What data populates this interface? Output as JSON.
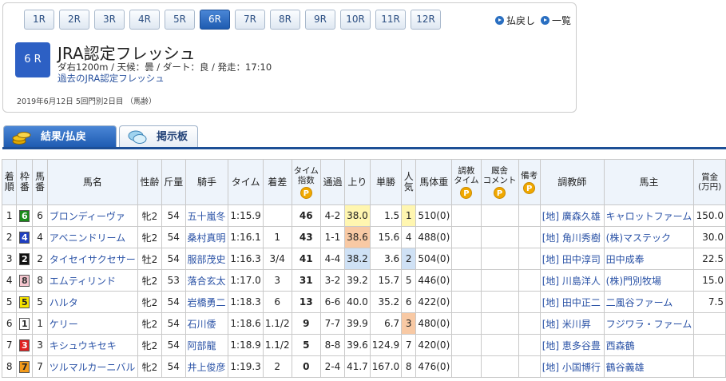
{
  "race_tabs": [
    "1R",
    "2R",
    "3R",
    "4R",
    "5R",
    "6R",
    "7R",
    "8R",
    "9R",
    "10R",
    "11R",
    "12R"
  ],
  "active_race": "6R",
  "nav": {
    "back": "払戻し",
    "list": "一覧"
  },
  "race": {
    "badge": "6 R",
    "name": "JRA認定フレッシュ",
    "info": "ダ右1200m / 天候：曇 / ダート：良 / 発走：17:10",
    "past_link": "過去のJRA認定フレッシュ",
    "date": "2019年6月12日 5回門別2日目 （馬齢）"
  },
  "tabs": {
    "results": "結果/払戻",
    "board": "掲示板"
  },
  "colors": {
    "accent": "#1d4f96",
    "badge": "#2d60c4"
  },
  "table": {
    "headers": {
      "rank": [
        "着",
        "順"
      ],
      "waku": [
        "枠",
        "番"
      ],
      "umaban": [
        "馬",
        "番"
      ],
      "horse": "馬名",
      "sexage": "性齢",
      "weight": "斤量",
      "jockey": "騎手",
      "time": "タイム",
      "margin": "着差",
      "index": [
        "タイム",
        "指数"
      ],
      "passing": "通過",
      "last": "上り",
      "odds": "単勝",
      "pop": [
        "人",
        "気"
      ],
      "body": "馬体重",
      "training": [
        "調教",
        "タイム"
      ],
      "stable": [
        "厩舎",
        "コメント"
      ],
      "note": "備考",
      "trainer": "調教師",
      "owner": "馬主",
      "prize": [
        "賞金",
        "(万円)"
      ],
      "p": "P"
    },
    "rows": [
      {
        "rank": "1",
        "waku": "6",
        "umaban": "6",
        "horse": "ブロンディーヴァ",
        "sexage": "牝2",
        "weight": "54",
        "jockey": "五十嵐冬",
        "time": "1:15.9",
        "margin": "",
        "index": "46",
        "passing": "4-2",
        "last": "38.0",
        "odds": "1.5",
        "pop": "1",
        "body": "510(0)",
        "trainer": "[地] 廣森久雄",
        "owner": "キャロットファーム",
        "prize": "150.0",
        "waku_bg": "#1a8a1a",
        "waku_fg": "#ffffff",
        "last_hl": "y",
        "pop_hl": "y"
      },
      {
        "rank": "2",
        "waku": "4",
        "umaban": "4",
        "horse": "アベニンドリーム",
        "sexage": "牝2",
        "weight": "54",
        "jockey": "桑村真明",
        "time": "1:16.1",
        "margin": "1",
        "index": "43",
        "passing": "1-1",
        "last": "38.6",
        "odds": "15.6",
        "pop": "4",
        "body": "488(0)",
        "trainer": "[地] 角川秀樹",
        "owner": "(株)マステック",
        "prize": "30.0",
        "waku_bg": "#1f3fc0",
        "waku_fg": "#ffffff",
        "last_hl": "o",
        "pop_hl": ""
      },
      {
        "rank": "3",
        "waku": "2",
        "umaban": "2",
        "horse": "タイセイサクセサー",
        "sexage": "牡2",
        "weight": "54",
        "jockey": "服部茂史",
        "time": "1:16.3",
        "margin": "3/4",
        "index": "41",
        "passing": "4-4",
        "last": "38.2",
        "odds": "3.6",
        "pop": "2",
        "body": "504(0)",
        "trainer": "[地] 田中淳司",
        "owner": "田中成奉",
        "prize": "22.5",
        "waku_bg": "#111111",
        "waku_fg": "#ffffff",
        "last_hl": "b",
        "pop_hl": "b"
      },
      {
        "rank": "4",
        "waku": "8",
        "umaban": "8",
        "horse": "エムティリンド",
        "sexage": "牝2",
        "weight": "53",
        "jockey": "落合玄太",
        "time": "1:17.0",
        "margin": "3",
        "index": "31",
        "passing": "3-2",
        "last": "39.2",
        "odds": "15.7",
        "pop": "5",
        "body": "446(0)",
        "trainer": "[地] 川島洋人",
        "owner": "(株)門別牧場",
        "prize": "15.0",
        "waku_bg": "#f6c6cf",
        "waku_fg": "#333333",
        "last_hl": "",
        "pop_hl": ""
      },
      {
        "rank": "5",
        "waku": "5",
        "umaban": "5",
        "horse": "ハルタ",
        "sexage": "牝2",
        "weight": "54",
        "jockey": "岩橋勇二",
        "time": "1:18.3",
        "margin": "6",
        "index": "13",
        "passing": "6-6",
        "last": "40.0",
        "odds": "35.2",
        "pop": "6",
        "body": "422(0)",
        "trainer": "[地] 田中正二",
        "owner": "二風谷ファーム",
        "prize": "7.5",
        "waku_bg": "#f7e400",
        "waku_fg": "#222222",
        "last_hl": "",
        "pop_hl": ""
      },
      {
        "rank": "6",
        "waku": "1",
        "umaban": "1",
        "horse": "ケリー",
        "sexage": "牝2",
        "weight": "54",
        "jockey": "石川倭",
        "time": "1:18.6",
        "margin": "1.1/2",
        "index": "9",
        "passing": "7-7",
        "last": "39.9",
        "odds": "6.7",
        "pop": "3",
        "body": "480(0)",
        "trainer": "[地] 米川昇",
        "owner": "フジワラ・ファーム",
        "prize": "",
        "waku_bg": "#ffffff",
        "waku_fg": "#222222",
        "last_hl": "",
        "pop_hl": "o"
      },
      {
        "rank": "7",
        "waku": "3",
        "umaban": "3",
        "horse": "キシュウキセキ",
        "sexage": "牝2",
        "weight": "54",
        "jockey": "阿部龍",
        "time": "1:18.9",
        "margin": "1.1/2",
        "index": "5",
        "passing": "8-8",
        "last": "39.6",
        "odds": "124.9",
        "pop": "7",
        "body": "420(0)",
        "trainer": "[地] 恵多谷豊",
        "owner": "西森鶴",
        "prize": "",
        "waku_bg": "#e02020",
        "waku_fg": "#ffffff",
        "last_hl": "",
        "pop_hl": ""
      },
      {
        "rank": "8",
        "waku": "7",
        "umaban": "7",
        "horse": "ツルマルカーニバル",
        "sexage": "牝2",
        "weight": "54",
        "jockey": "井上俊彦",
        "time": "1:19.3",
        "margin": "2",
        "index": "0",
        "passing": "2-4",
        "last": "41.7",
        "odds": "167.0",
        "pop": "8",
        "body": "476(0)",
        "trainer": "[地] 小国博行",
        "owner": "鶴谷義雄",
        "prize": "",
        "waku_bg": "#f39a1a",
        "waku_fg": "#222222",
        "last_hl": "",
        "pop_hl": ""
      }
    ]
  }
}
